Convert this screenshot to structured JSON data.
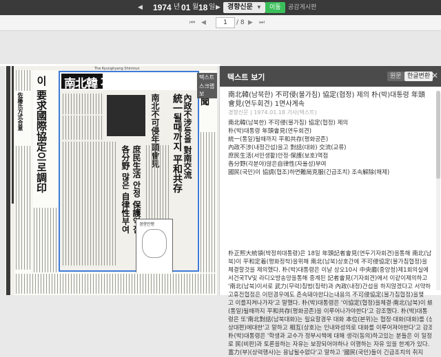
{
  "topbar": {
    "year": "1974",
    "year_unit": "년",
    "month": "01",
    "month_unit": "월",
    "day": "18",
    "day_unit": "일",
    "newspaper": "경향신문",
    "move_label": "이동",
    "link_label": "공감게시판"
  },
  "pager": {
    "current": "1",
    "total": "/ 8"
  },
  "newspaper_image": {
    "masthead_line": "The Kyunghyang Shinmun",
    "headline_main": "南北韓 不可侵協定제의",
    "side_headline": "이 要求國際協定으로調印",
    "right_headline": "統一될때까지 平和共存",
    "right_sub": "內政不涉등을 對南交流",
    "col_headline": "各分野 많은 自律性부여",
    "col_headline2": "庶民生活 안정 保護역점",
    "paper_name": "新聞",
    "cartoon_caption": "경향만평",
    "overlay_tab1": "텍스트 보",
    "overlay_tab2": "스크랩 보"
  },
  "panel": {
    "header_title": "텍스트 보기",
    "btn_original": "원문",
    "btn_hanja": "한글변환",
    "article_title": "南北韓(남북한) 不可侵(불가침) 協定(협정) 제의 朴(박)대통령 年頭會見(연두회견) 1면사계속",
    "meta": "경향신문 | 1974.01.18 기사(텍스트)",
    "body_lines": [
      "南北韓(남북한) 不可侵(불가침) 協定(협정) 제의",
      "朴(박)대통령 年頭會見(연두회견)",
      "統一(통일)될때까지 平和共存(평화공존)",
      "內政不涉(내정간섭)을고 對話(대화)  交流(교류)",
      "庶民生活(서민생활)안정·保護(보호)역점",
      "各分野(각분야)많은自律性(자율성)부여",
      "國民(국민)이 協調(협조)하면難局克服(긴급조치) 조속解除(해제)"
    ],
    "para2_lines": [
      "朴正熙大統領(박정희대통령)은 18일 年頭記者會見(연두기자회견)을통해 南北(남",
      "북)이 平和定着(평화정착)을위해 南北(남북)상호간에 不可侵協定(불가침협정)을",
      "체결할것을 제의했다. 朴(박)대통령은 이날 상오10시 中央廳(중앙청)제1회의실에",
      "서건국TV및 라디오방송망을통해 중계된 記者會見(기자회견)에서 이같이제의하고",
      "'南北(남북)이서로 武力(무력)침범(침략)과 內政(내정)간섭을 하지않겠다고 서약하",
      "고휴전협정은 어떤경우에도 존속돼야한다는내용의 不可侵協定(불가침협정)을맺",
      "고 이를지켜나가자'고 말했다. 朴(박)대통령은 '이協定(협정)을체결·南北(남북)이 統一",
      "(통일)될때까지 平和共存(평화공존)을 이루어나가야한다'고 강조했다. 朴(박)대통",
      "령은 또'南北對話(남북대화)는 필요할경우 대화 本位(본위)는 협정·대화(대화)를 (상호",
      "상대편)에대한'고 말하고 相互(상호)는 인내와성의로 대화를 이루어져야한다'고 강조하다.",
      "朴(박)대통령은 '학생과 교수가 정부시책에 대해 생각(동의)하고있는 분들은 이 일정으",
      "로 民(비판)과 토론을하는 자유는 보장되어야하나 이행하는 자유 있을 한계가 있다.",
      "富力(부)(상력행사)는 용납될수없다'고 말하고 '國民(국민)들이 긴급조치의 취지"
    ]
  }
}
